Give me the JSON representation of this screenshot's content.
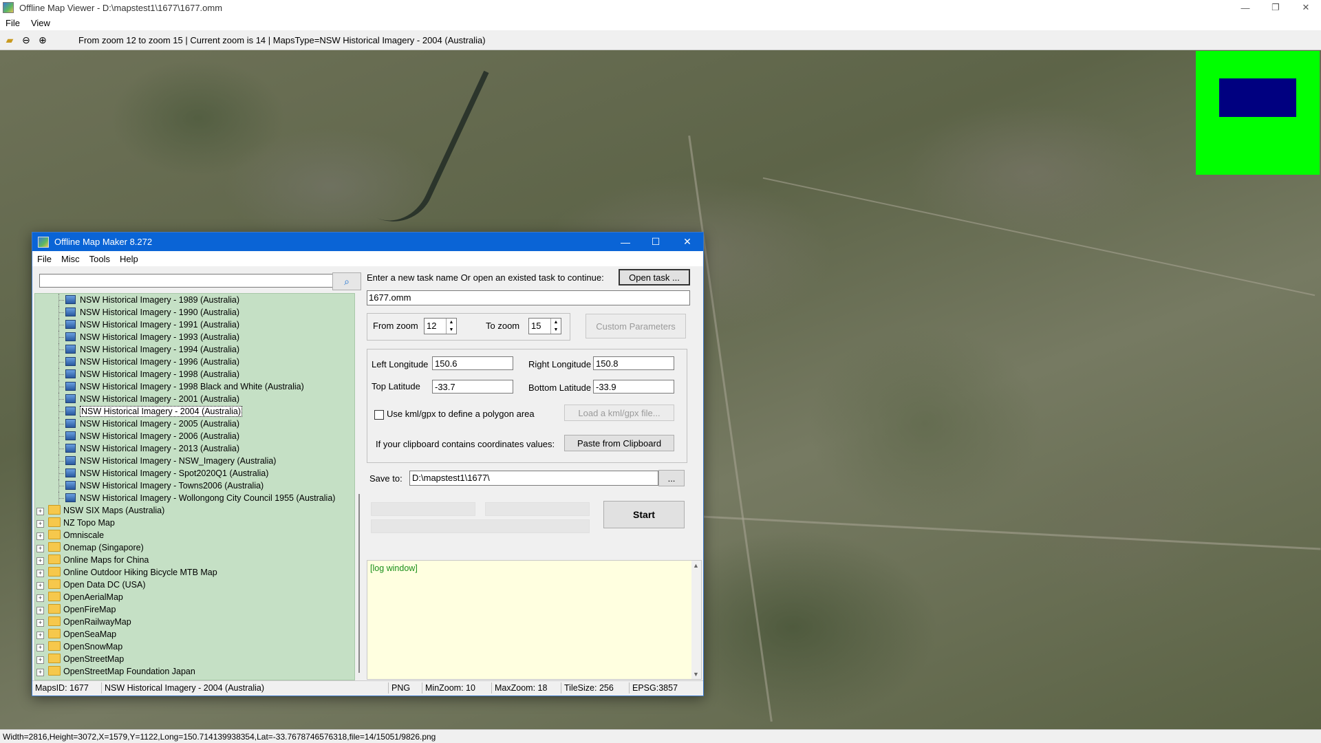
{
  "viewer": {
    "title": "Offline Map Viewer - D:\\mapstest1\\1677\\1677.omm",
    "menu": [
      "File",
      "View"
    ],
    "toolbar_status": "From zoom 12 to zoom 15   |   Current zoom is 14  |   MapsType=NSW Historical Imagery - 2004 (Australia)",
    "status_bar": "Width=2816,Height=3072,X=1579,Y=1122,Long=150.714139938354,Lat=-33.7678746576318,file=14/15051/9826.png",
    "controls": {
      "minimize": "—",
      "restore": "❐",
      "close": "✕"
    }
  },
  "colors": {
    "overview_bg": "#00ff00",
    "overview_viewport": "#000080",
    "tree_bg": "#c5e0c5",
    "log_bg": "#ffffe0",
    "titlebar": "#0a64d6"
  },
  "maker": {
    "title": "Offline Map Maker 8.272",
    "menu": [
      "File",
      "Misc",
      "Tools",
      "Help"
    ],
    "search": {
      "value": "",
      "placeholder": ""
    },
    "tree_children": [
      "NSW Historical Imagery - 1989 (Australia)",
      "NSW Historical Imagery - 1990 (Australia)",
      "NSW Historical Imagery - 1991 (Australia)",
      "NSW Historical Imagery - 1993 (Australia)",
      "NSW Historical Imagery - 1994 (Australia)",
      "NSW Historical Imagery - 1996 (Australia)",
      "NSW Historical Imagery - 1998 (Australia)",
      "NSW Historical Imagery - 1998 Black and White (Australia)",
      "NSW Historical Imagery - 2001 (Australia)",
      "NSW Historical Imagery - 2004 (Australia)",
      "NSW Historical Imagery - 2005 (Australia)",
      "NSW Historical Imagery - 2006 (Australia)",
      "NSW Historical Imagery - 2013 (Australia)",
      "NSW Historical Imagery - NSW_Imagery (Australia)",
      "NSW Historical Imagery - Spot2020Q1 (Australia)",
      "NSW Historical Imagery - Towns2006 (Australia)",
      "NSW Historical Imagery - Wollongong City Council 1955 (Australia)"
    ],
    "selected_index": 9,
    "tree_folders": [
      "NSW SIX Maps (Australia)",
      "NZ Topo Map",
      "Omniscale",
      "Onemap (Singapore)",
      "Online Maps for China",
      "Online Outdoor Hiking Bicycle MTB Map",
      "Open Data DC (USA)",
      "OpenAerialMap",
      "OpenFireMap",
      "OpenRailwayMap",
      "OpenSeaMap",
      "OpenSnowMap",
      "OpenStreetMap",
      "OpenStreetMap Foundation Japan"
    ],
    "task_label": "Enter a new task name Or open an existed task to continue:",
    "open_task_label": "Open task ...",
    "task_name": "1677.omm",
    "from_zoom_label": "From zoom",
    "from_zoom": "12",
    "to_zoom_label": "To zoom",
    "to_zoom": "15",
    "custom_params_label": "Custom Parameters",
    "left_lon_label": "Left Longitude",
    "left_lon": "150.6",
    "right_lon_label": "Right Longitude",
    "right_lon": "150.8",
    "top_lat_label": "Top Latitude",
    "top_lat": "-33.7",
    "bottom_lat_label": "Bottom Latitude",
    "bottom_lat": "-33.9",
    "kml_label": "Use kml/gpx to define a polygon area",
    "load_kml_label": "Load a kml/gpx file...",
    "clipboard_label": "If your clipboard contains coordinates values:",
    "paste_label": "Paste from Clipboard",
    "save_label": "Save to:",
    "save_path": "D:\\mapstest1\\1677\\",
    "browse_label": "...",
    "start_label": "Start",
    "log_text": "[log window]",
    "status": {
      "maps_id": "MapsID: 1677",
      "maps_name": "NSW Historical Imagery - 2004 (Australia)",
      "format": "PNG",
      "min_zoom": "MinZoom: 10",
      "max_zoom": "MaxZoom: 18",
      "tile_size": "TileSize: 256",
      "epsg": "EPSG:3857"
    }
  }
}
